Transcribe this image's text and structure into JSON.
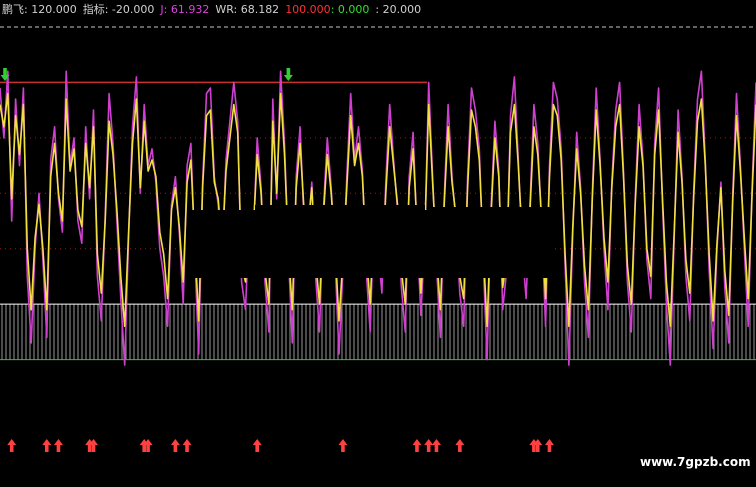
{
  "header": {
    "items": [
      {
        "text": "鹏飞: 120.000",
        "color": "#d0d0d0"
      },
      {
        "text": "指标: -20.000",
        "color": "#d0d0d0"
      },
      {
        "text": "J: 61.932",
        "color": "#e040e0"
      },
      {
        "text": "WR: 68.182",
        "color": "#d0d0d0"
      },
      {
        "text": "100.000",
        "color": "#ff3030"
      },
      {
        "text": ": 0.000",
        "color": "#30e030"
      },
      {
        "text": ": 20.000",
        "color": "#d0d0d0"
      }
    ]
  },
  "watermark": "www.7gpzb.com",
  "chart_data": {
    "type": "line",
    "ylim": [
      -20,
      120
    ],
    "reference_lines": [
      {
        "value": 120,
        "style": "dashed",
        "color": "#c8c8c8"
      },
      {
        "value": 100,
        "style": "solid",
        "color": "#c83030"
      },
      {
        "value": 20,
        "style": "solid",
        "color": "#ffffff"
      },
      {
        "value": 0,
        "style": "solid",
        "color": "#30c030"
      }
    ],
    "gridlines": [
      80,
      60,
      40
    ],
    "band": {
      "from": 0,
      "to": 20,
      "pattern": "vertical-hatch",
      "color": "#c8c8c8"
    },
    "series": [
      {
        "name": "WR",
        "color": "#f0e040",
        "values": [
          92,
          84,
          96,
          58,
          88,
          74,
          92,
          40,
          18,
          44,
          56,
          40,
          18,
          66,
          78,
          60,
          50,
          94,
          68,
          76,
          54,
          48,
          78,
          62,
          84,
          38,
          24,
          50,
          86,
          74,
          54,
          30,
          12,
          46,
          78,
          94,
          62,
          86,
          68,
          72,
          66,
          46,
          38,
          22,
          54,
          62,
          48,
          28,
          64,
          72,
          42,
          14,
          62,
          88,
          90,
          64,
          58,
          40,
          68,
          80,
          92,
          82,
          34,
          28,
          50,
          46,
          74,
          60,
          32,
          20,
          86,
          60,
          96,
          74,
          40,
          18,
          62,
          78,
          54,
          48,
          62,
          36,
          20,
          52,
          74,
          60,
          40,
          14,
          36,
          62,
          88,
          70,
          78,
          66,
          38,
          20,
          52,
          44,
          30,
          60,
          84,
          70,
          56,
          32,
          20,
          62,
          76,
          48,
          24,
          46,
          92,
          64,
          38,
          18,
          56,
          84,
          64,
          52,
          30,
          22,
          62,
          90,
          84,
          72,
          40,
          12,
          52,
          80,
          66,
          26,
          36,
          82,
          92,
          70,
          44,
          30,
          54,
          84,
          74,
          50,
          22,
          66,
          92,
          88,
          72,
          38,
          12,
          48,
          76,
          60,
          34,
          18,
          58,
          90,
          70,
          44,
          28,
          62,
          84,
          92,
          66,
          34,
          20,
          56,
          84,
          70,
          40,
          30,
          74,
          90,
          58,
          28,
          12,
          46,
          82,
          64,
          36,
          24,
          58,
          86,
          94,
          70,
          38,
          14,
          42,
          62,
          32,
          16,
          56,
          88,
          68,
          44,
          22,
          60,
          92
        ]
      },
      {
        "name": "J",
        "color": "#d040d0",
        "values": [
          98,
          80,
          104,
          50,
          94,
          70,
          98,
          30,
          6,
          40,
          60,
          36,
          8,
          72,
          84,
          58,
          46,
          104,
          70,
          80,
          50,
          42,
          84,
          58,
          90,
          30,
          14,
          52,
          96,
          78,
          50,
          22,
          -2,
          44,
          84,
          102,
          60,
          92,
          70,
          76,
          64,
          40,
          30,
          12,
          56,
          66,
          46,
          20,
          70,
          78,
          38,
          2,
          64,
          96,
          98,
          66,
          56,
          36,
          72,
          86,
          100,
          86,
          28,
          18,
          52,
          44,
          80,
          62,
          28,
          10,
          94,
          58,
          104,
          78,
          38,
          6,
          66,
          84,
          50,
          44,
          64,
          30,
          10,
          54,
          80,
          62,
          36,
          2,
          32,
          66,
          96,
          72,
          84,
          68,
          32,
          10,
          54,
          40,
          24,
          64,
          92,
          72,
          54,
          26,
          10,
          66,
          82,
          46,
          16,
          44,
          100,
          66,
          34,
          8,
          58,
          92,
          66,
          50,
          24,
          12,
          66,
          98,
          90,
          76,
          36,
          0,
          54,
          86,
          68,
          18,
          32,
          88,
          102,
          72,
          40,
          22,
          56,
          92,
          78,
          48,
          12,
          70,
          100,
          94,
          76,
          34,
          -2,
          46,
          82,
          62,
          28,
          8,
          60,
          98,
          72,
          40,
          18,
          64,
          90,
          100,
          68,
          28,
          10,
          58,
          92,
          72,
          36,
          22,
          78,
          98,
          56,
          20,
          -2,
          44,
          90,
          66,
          30,
          14,
          60,
          94,
          104,
          72,
          32,
          4,
          40,
          64,
          26,
          6,
          58,
          96,
          70,
          40,
          12,
          62,
          100
        ]
      }
    ],
    "markers": {
      "up_arrows": {
        "color": "#ff4040",
        "at_index": [
          3,
          12,
          15,
          23,
          24,
          37,
          38,
          45,
          48,
          66,
          88,
          107,
          110,
          112,
          118,
          137,
          138,
          141
        ]
      },
      "down_arrows": {
        "color": "#30d030",
        "at_index": [
          0,
          74
        ]
      }
    }
  }
}
